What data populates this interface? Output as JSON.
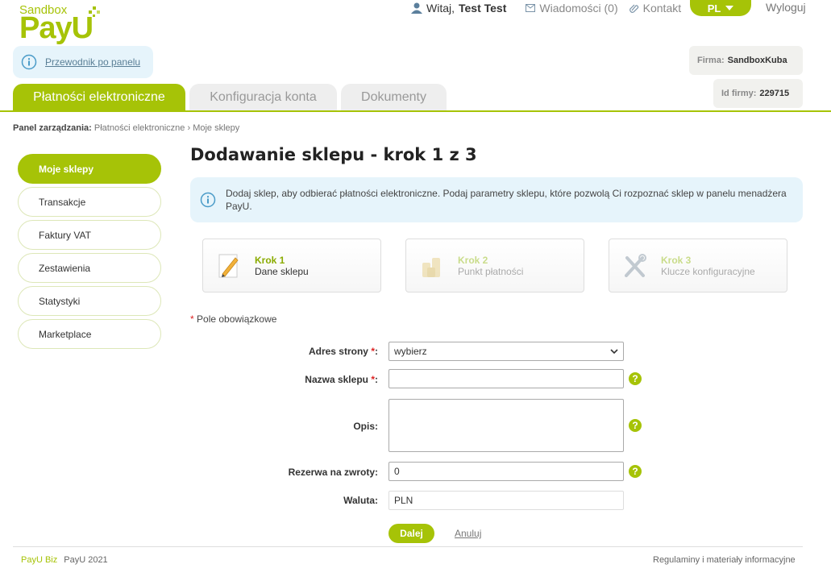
{
  "brand": {
    "sandbox": "Sandbox",
    "logo": "PayU",
    "accent": "#a6c307"
  },
  "topnav": {
    "greeting_prefix": "Witaj,",
    "user": "Test Test",
    "messages": "Wiadomości (0)",
    "contact": "Kontakt",
    "lang": "PL",
    "logout": "Wyloguj"
  },
  "guide": {
    "link": "Przewodnik po panelu"
  },
  "firm": {
    "name_label": "Firma:",
    "name": "SandboxKuba",
    "id_label": "Id firmy:",
    "id": "229715"
  },
  "tabs": [
    "Płatności elektroniczne",
    "Konfiguracja konta",
    "Dokumenty"
  ],
  "breadcrumb": {
    "label": "Panel zarządzania:",
    "item1": "Płatności elektroniczne",
    "sep": "›",
    "item2": "Moje sklepy"
  },
  "sidebar": [
    "Moje sklepy",
    "Transakcje",
    "Faktury VAT",
    "Zestawienia",
    "Statystyki",
    "Marketplace"
  ],
  "page": {
    "title": "Dodawanie sklepu - krok 1 z 3",
    "info": "Dodaj sklep, aby odbierać płatności elektroniczne. Podaj parametry sklepu, które pozwolą Ci rozpoznać sklep w panelu menadżera PayU."
  },
  "steps": [
    {
      "title": "Krok 1",
      "subtitle": "Dane sklepu",
      "icon": "pencil-paper-icon"
    },
    {
      "title": "Krok 2",
      "subtitle": "Punkt płatności",
      "icon": "coins-icon"
    },
    {
      "title": "Krok 3",
      "subtitle": "Klucze konfiguracyjne",
      "icon": "tools-icon"
    }
  ],
  "form": {
    "required_note": "Pole obowiązkowe",
    "star": "*",
    "address_label": "Adres strony",
    "address_value": "wybierz",
    "name_label": "Nazwa sklepu",
    "name_value": "",
    "desc_label": "Opis:",
    "desc_value": "",
    "reserve_label": "Rezerwa na zwroty:",
    "reserve_value": "0",
    "currency_label": "Waluta:",
    "currency_value": "PLN",
    "help": "?",
    "next": "Dalej",
    "cancel": "Anuluj"
  },
  "footer": {
    "mini_logo": "PayU",
    "mini_biz": "Biz",
    "copyright": "PayU 2021",
    "links": "Regulaminy i materiały informacyjne"
  }
}
